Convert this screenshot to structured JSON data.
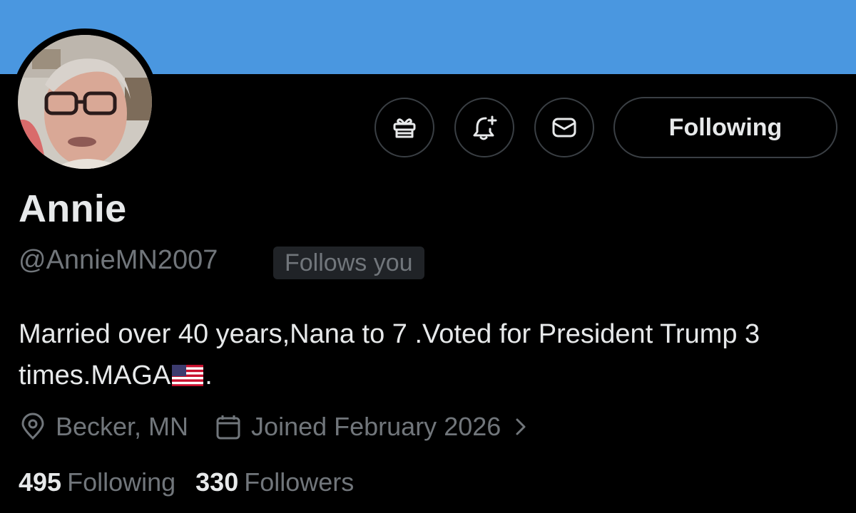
{
  "colors": {
    "banner": "#4a97e0",
    "background": "#000000",
    "primary_text": "#e7e9ea",
    "secondary_text": "#71767b"
  },
  "profile": {
    "display_name": "Annie",
    "handle": "@AnnieMN2007",
    "follows_you_badge": "Follows you",
    "bio_text": "Married over 40 years,Nana to 7 .Voted for President Trump 3 times.MAGA",
    "bio_end": ".",
    "bio_emoji": "us-flag-emoji",
    "location": "Becker, MN",
    "joined": "Joined February 2026"
  },
  "actions": {
    "gift_icon": "gift-icon",
    "subscribe_icon": "bell-plus-icon",
    "message_icon": "mail-icon",
    "follow_label": "Following"
  },
  "stats": {
    "following_count": "495",
    "following_label": "Following",
    "followers_count": "330",
    "followers_label": "Followers"
  }
}
